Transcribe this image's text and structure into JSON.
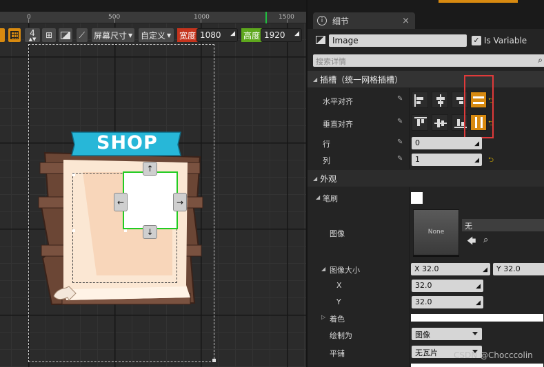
{
  "ruler": {
    "labels": [
      "0",
      "500",
      "1000",
      "1500"
    ]
  },
  "viewport_toolbar": {
    "dpi_value": "4",
    "screen_size": "屏幕尺寸",
    "custom": "自定义",
    "width_label": "宽度",
    "width_value": "1080",
    "height_label": "高度",
    "height_value": "1920"
  },
  "shop_sign": {
    "text": "SHOP"
  },
  "arrows": {
    "up": "↑",
    "down": "↓",
    "left": "←",
    "right": "→"
  },
  "details": {
    "tab_title": "细节",
    "close": "×",
    "name_value": "Image",
    "is_variable_label": "Is Variable",
    "search_placeholder": "搜索详情",
    "slot_category": "插槽（统一网格插槽）",
    "h_align_label": "水平对齐",
    "v_align_label": "垂直对齐",
    "row_label": "行",
    "row_value": "0",
    "column_label": "列",
    "column_value": "1",
    "appearance_category": "外观",
    "brush_label": "笔刷",
    "image_label": "图像",
    "image_thumb_text": "None",
    "image_asset_value": "无",
    "image_size_label": "图像大小",
    "size_x_compact": "X  32.0",
    "size_y_compact": "Y  32.0",
    "x_label": "X",
    "x_value": "32.0",
    "y_label": "Y",
    "y_value": "32.0",
    "tint_label": "着色",
    "draw_as_label": "绘制为",
    "draw_as_value": "图像",
    "tiling_label": "平铺",
    "tiling_value": "无瓦片"
  },
  "watermark": "CSDN @Chocccolin",
  "colors": {
    "accent": "#d88a10",
    "selection_green": "#22cc22",
    "highlight_red": "#e03a3a",
    "sign_blue": "#27b7d8"
  }
}
